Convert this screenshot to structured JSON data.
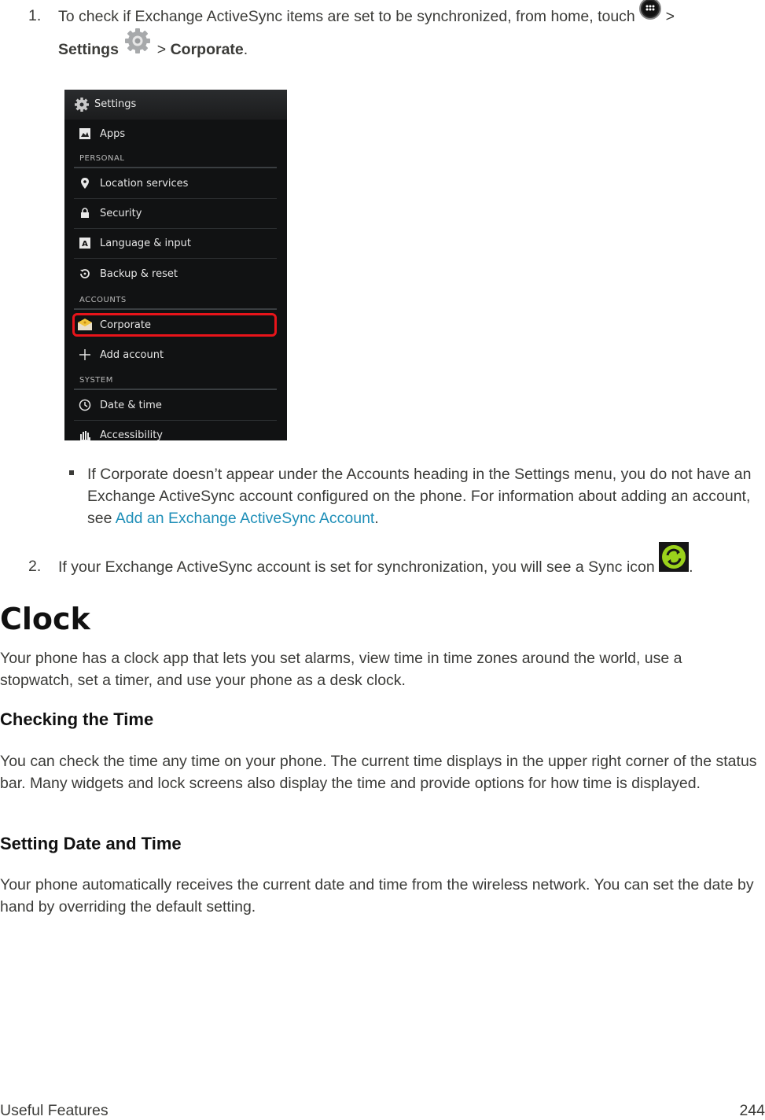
{
  "steps": [
    {
      "number": "1.",
      "text_before_icon": "To check if Exchange ActiveSync items are set to be synchronized, from home, touch",
      "icon1": "apps-launcher-icon",
      "sep1": ">",
      "settings_label": "Settings",
      "icon2": "settings-gear-icon",
      "sep2": ">",
      "corporate_label": "Corporate",
      "end": "."
    },
    {
      "number": "2.",
      "text": "If your Exchange ActiveSync account is set for synchronization, you will see a Sync icon",
      "icon": "sync-icon",
      "end": "."
    }
  ],
  "phone_screen": {
    "title": "Settings",
    "title_icon": "settings-gear-icon",
    "items": [
      {
        "label": "Apps",
        "icon": "apps-icon"
      },
      {
        "section": "PERSONAL"
      },
      {
        "label": "Location services",
        "icon": "location-pin-icon"
      },
      {
        "label": "Security",
        "icon": "lock-icon"
      },
      {
        "label": "Language & input",
        "icon": "keyboard-a-icon"
      },
      {
        "label": "Backup & reset",
        "icon": "backup-restore-icon"
      },
      {
        "section": "ACCOUNTS"
      },
      {
        "label": "Corporate",
        "icon": "corporate-mail-icon",
        "highlighted": true
      },
      {
        "label": "Add account",
        "icon": "plus-icon"
      },
      {
        "section": "SYSTEM"
      },
      {
        "label": "Date & time",
        "icon": "clock-icon"
      },
      {
        "label": "Accessibility",
        "icon": "hand-icon"
      }
    ],
    "highlight_color": "#e8141a"
  },
  "bullet_note": {
    "text": "If Corporate doesn’t appear under the Accounts heading in the Settings menu, you do not have an Exchange ActiveSync account configured on the phone. For information about adding an account, see",
    "link_text": "Add an Exchange ActiveSync Account",
    "end": "."
  },
  "section": {
    "title": "Clock",
    "intro": "Your phone has a clock app that lets you set alarms, view time in time zones around the world, use a stopwatch, set a timer, and use your phone as a desk clock.",
    "subsections": [
      {
        "heading": "Checking the Time",
        "body": "You can check the time any time on your phone. The current time displays in the upper right corner of the status bar. Many widgets and lock screens also display the time and provide options for how time is displayed."
      },
      {
        "heading": "Setting Date and Time",
        "body": "Your phone automatically receives the current date and time from the wireless network. You can set the date by hand by overriding the default setting."
      }
    ]
  },
  "footer": {
    "chapter": "Useful Features",
    "page": "244"
  },
  "colors": {
    "link": "#1f8fb8",
    "text": "#3b3b38",
    "sync_green": "#9bd21b"
  }
}
